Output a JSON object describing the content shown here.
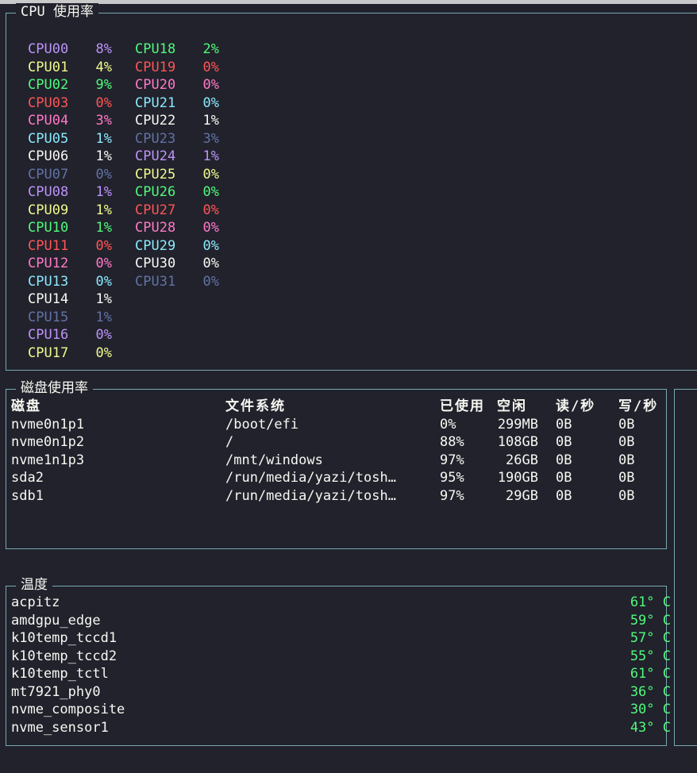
{
  "colors": {
    "purple": "#bd93f9",
    "yellow": "#f1fa8c",
    "green": "#50fa7b",
    "red": "#ff5555",
    "pink": "#ff79c6",
    "cyan": "#8be9fd",
    "white": "#f8f8f2",
    "gray": "#6272a4",
    "border": "#7aa9b3"
  },
  "cpu": {
    "title": "CPU 使用率",
    "columns": [
      [
        {
          "name": "CPU00",
          "value": "8%",
          "color": "#bd93f9"
        },
        {
          "name": "CPU01",
          "value": "4%",
          "color": "#f1fa8c"
        },
        {
          "name": "CPU02",
          "value": "9%",
          "color": "#50fa7b"
        },
        {
          "name": "CPU03",
          "value": "0%",
          "color": "#ff5555"
        },
        {
          "name": "CPU04",
          "value": "3%",
          "color": "#ff79c6"
        },
        {
          "name": "CPU05",
          "value": "1%",
          "color": "#8be9fd"
        },
        {
          "name": "CPU06",
          "value": "1%",
          "color": "#f8f8f2"
        },
        {
          "name": "CPU07",
          "value": "0%",
          "color": "#6272a4"
        },
        {
          "name": "CPU08",
          "value": "1%",
          "color": "#bd93f9"
        },
        {
          "name": "CPU09",
          "value": "1%",
          "color": "#f1fa8c"
        },
        {
          "name": "CPU10",
          "value": "1%",
          "color": "#50fa7b"
        },
        {
          "name": "CPU11",
          "value": "0%",
          "color": "#ff5555"
        },
        {
          "name": "CPU12",
          "value": "0%",
          "color": "#ff79c6"
        },
        {
          "name": "CPU13",
          "value": "0%",
          "color": "#8be9fd"
        },
        {
          "name": "CPU14",
          "value": "1%",
          "color": "#f8f8f2"
        },
        {
          "name": "CPU15",
          "value": "1%",
          "color": "#6272a4"
        },
        {
          "name": "CPU16",
          "value": "0%",
          "color": "#bd93f9"
        },
        {
          "name": "CPU17",
          "value": "0%",
          "color": "#f1fa8c"
        }
      ],
      [
        {
          "name": "CPU18",
          "value": "2%",
          "color": "#50fa7b"
        },
        {
          "name": "CPU19",
          "value": "0%",
          "color": "#ff5555"
        },
        {
          "name": "CPU20",
          "value": "0%",
          "color": "#ff79c6"
        },
        {
          "name": "CPU21",
          "value": "0%",
          "color": "#8be9fd"
        },
        {
          "name": "CPU22",
          "value": "1%",
          "color": "#f8f8f2"
        },
        {
          "name": "CPU23",
          "value": "3%",
          "color": "#6272a4"
        },
        {
          "name": "CPU24",
          "value": "1%",
          "color": "#bd93f9"
        },
        {
          "name": "CPU25",
          "value": "0%",
          "color": "#f1fa8c"
        },
        {
          "name": "CPU26",
          "value": "0%",
          "color": "#50fa7b"
        },
        {
          "name": "CPU27",
          "value": "0%",
          "color": "#ff5555"
        },
        {
          "name": "CPU28",
          "value": "0%",
          "color": "#ff79c6"
        },
        {
          "name": "CPU29",
          "value": "0%",
          "color": "#8be9fd"
        },
        {
          "name": "CPU30",
          "value": "0%",
          "color": "#f8f8f2"
        },
        {
          "name": "CPU31",
          "value": "0%",
          "color": "#6272a4"
        }
      ]
    ]
  },
  "disk": {
    "title": "磁盘使用率",
    "headers": {
      "disk": "磁盘",
      "fs": "文件系统",
      "used": "已使用",
      "free": "空闲",
      "read": "读/秒",
      "write": "写/秒"
    },
    "rows": [
      {
        "disk": "nvme0n1p1",
        "fs": "/boot/efi",
        "used": "0%",
        "free": "299MB",
        "read": "0B",
        "write": "0B"
      },
      {
        "disk": "nvme0n1p2",
        "fs": "/",
        "used": "88%",
        "free": "108GB",
        "read": "0B",
        "write": "0B"
      },
      {
        "disk": "nvme1n1p3",
        "fs": "/mnt/windows",
        "used": "97%",
        "free": "26GB",
        "read": "0B",
        "write": "0B"
      },
      {
        "disk": "sda2",
        "fs": "/run/media/yazi/tosh…",
        "used": "95%",
        "free": "190GB",
        "read": "0B",
        "write": "0B"
      },
      {
        "disk": "sdb1",
        "fs": "/run/media/yazi/tosh…",
        "used": "97%",
        "free": "29GB",
        "read": "0B",
        "write": "0B"
      }
    ]
  },
  "temp": {
    "title": "温度",
    "rows": [
      {
        "name": "acpitz",
        "value": "61° C"
      },
      {
        "name": "amdgpu_edge",
        "value": "59° C"
      },
      {
        "name": "k10temp_tccd1",
        "value": "57° C"
      },
      {
        "name": "k10temp_tccd2",
        "value": "55° C"
      },
      {
        "name": "k10temp_tctl",
        "value": "61° C"
      },
      {
        "name": "mt7921_phy0",
        "value": "36° C"
      },
      {
        "name": "nvme_composite",
        "value": "30° C"
      },
      {
        "name": "nvme_sensor1",
        "value": "43° C"
      }
    ]
  }
}
